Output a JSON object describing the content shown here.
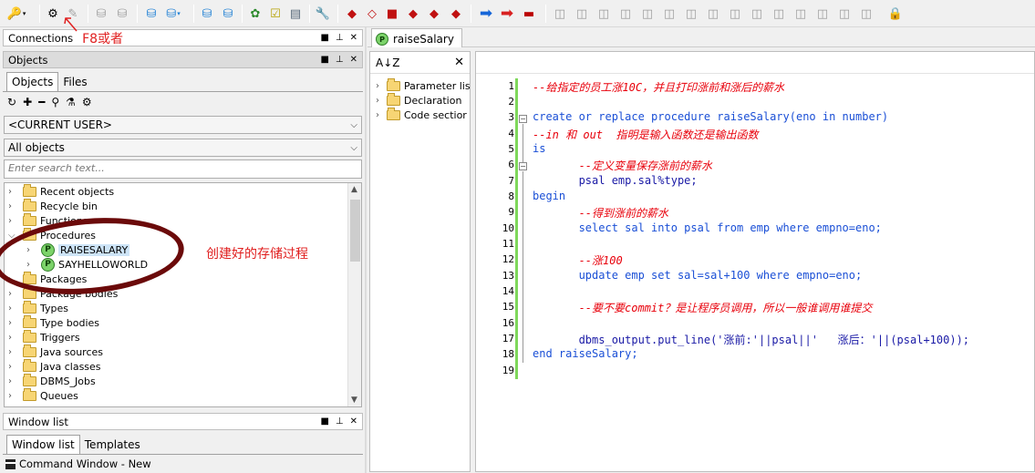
{
  "toolbar": {
    "icons": [
      "key-icon",
      "gear-icon",
      "wand-icon",
      "db-icon",
      "db-up-icon",
      "db-sql-icon",
      "db-sql2-icon",
      "execute-icon",
      "stop-icon",
      "tools-icon",
      "check-icon",
      "report-icon",
      "wrench-icon",
      "obj1-icon",
      "eraser-icon",
      "cube-icon",
      "obj4-icon",
      "obj5-icon",
      "obj6-icon",
      "arrow-blue-icon",
      "arrow-red-icon",
      "truck-icon"
    ],
    "annotation": "F8或者"
  },
  "connections": {
    "title": "Connections"
  },
  "objects": {
    "title": "Objects",
    "tabs": [
      "Objects",
      "Files"
    ],
    "user_combo": "<CURRENT USER>",
    "filter_combo": "All objects",
    "search_placeholder": "Enter search text...",
    "tree": [
      {
        "label": "Recent objects",
        "type": "folder",
        "expanded": false
      },
      {
        "label": "Recycle bin",
        "type": "folder",
        "expanded": false
      },
      {
        "label": "Functions",
        "type": "folder",
        "expanded": false
      },
      {
        "label": "Procedures",
        "type": "folder",
        "expanded": true
      },
      {
        "label": "RAISESALARY",
        "type": "proc",
        "selected": true
      },
      {
        "label": "SAYHELLOWORLD",
        "type": "proc"
      },
      {
        "label": "Packages",
        "type": "folder"
      },
      {
        "label": "Package bodies",
        "type": "folder"
      },
      {
        "label": "Types",
        "type": "folder"
      },
      {
        "label": "Type bodies",
        "type": "folder"
      },
      {
        "label": "Triggers",
        "type": "folder"
      },
      {
        "label": "Java sources",
        "type": "folder"
      },
      {
        "label": "Java classes",
        "type": "folder"
      },
      {
        "label": "DBMS_Jobs",
        "type": "folder"
      },
      {
        "label": "Queues",
        "type": "folder"
      }
    ],
    "annotation": "创建好的存储过程"
  },
  "window_list": {
    "title": "Window list",
    "tabs": [
      "Window list",
      "Templates"
    ],
    "item": "Command Window - New"
  },
  "editor": {
    "tab": "raiseSalary",
    "outline": [
      "Parameter lis",
      "Declaration",
      "Code sectior"
    ],
    "lines": [
      "--给指定的员工涨10C，并且打印涨前和涨后的薪水",
      "",
      "create or replace procedure raiseSalary(eno in number)",
      "--in 和 out  指明是输入函数还是输出函数",
      "is",
      "       --定义变量保存涨前的薪水",
      "       psal emp.sal%type;",
      "begin",
      "       --得到涨前的薪水",
      "       select sal into psal from emp where empno=eno;",
      "",
      "       --涨100",
      "       update emp set sal=sal+100 where empno=eno;",
      "",
      "       --要不要commit？是让程序员调用，所以一般谁调用谁提交",
      "",
      "       dbms_output.put_line('涨前:'||psal||'   涨后：'||(psal+100));",
      "end raiseSalary;",
      ""
    ],
    "line_numbers": [
      "1",
      "2",
      "3",
      "4",
      "5",
      "6",
      "7",
      "8",
      "9",
      "10",
      "11",
      "12",
      "13",
      "14",
      "15",
      "16",
      "17",
      "18",
      "19"
    ]
  }
}
